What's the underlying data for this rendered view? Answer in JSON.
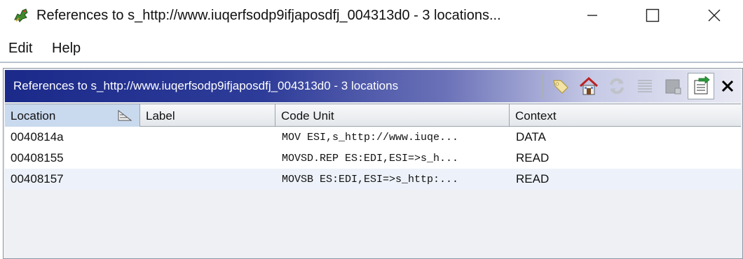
{
  "window": {
    "title": "References to s_http://www.iuqerfsodp9ifjaposdfj_004313d0 - 3 locations...",
    "app_icon": "ghidra-dragon-icon",
    "controls": [
      "minimize-icon",
      "maximize-icon",
      "close-icon"
    ]
  },
  "menu": {
    "edit": "Edit",
    "help": "Help"
  },
  "panel": {
    "title": "References to s_http://www.iuqerfsodp9ifjaposdfj_004313d0 - 3 locations",
    "toolbar": [
      "tag-icon",
      "home-icon",
      "refresh-icon",
      "list-icon",
      "snapshot-icon",
      "export-icon",
      "close-icon"
    ]
  },
  "table": {
    "columns": {
      "location": "Location",
      "label": "Label",
      "code_unit": "Code Unit",
      "context": "Context"
    },
    "rows": [
      {
        "location": "0040814a",
        "label": "",
        "code_unit": "MOV ESI,s_http://www.iuqe...",
        "context": "DATA"
      },
      {
        "location": "00408155",
        "label": "",
        "code_unit": "MOVSD.REP ES:EDI,ESI=>s_h...",
        "context": "READ"
      },
      {
        "location": "00408157",
        "label": "",
        "code_unit": "MOVSB ES:EDI,ESI=>s_http:...",
        "context": "READ"
      }
    ]
  },
  "colors": {
    "header_gradient_start": "#1b2a8a",
    "sorted_column": "#c9d9ee",
    "alt_row": "#edf2fa"
  }
}
